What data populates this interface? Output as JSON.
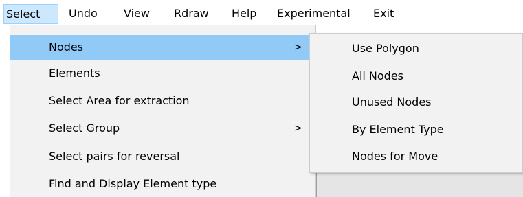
{
  "menubar": {
    "items": [
      {
        "label": "Select",
        "active": true
      },
      {
        "label": "Undo"
      },
      {
        "label": "View"
      },
      {
        "label": "Rdraw"
      },
      {
        "label": "Help"
      },
      {
        "label": "Experimental"
      },
      {
        "label": "Exit"
      }
    ]
  },
  "select_menu": {
    "items": [
      {
        "label": "Nodes",
        "submenu_arrow": ">"
      },
      {
        "label": "Elements"
      },
      {
        "label": "Select Area for extraction"
      },
      {
        "label": "Select Group",
        "submenu_arrow": ">"
      },
      {
        "label": "Select pairs for reversal"
      },
      {
        "label": "Find and Display Element type"
      }
    ]
  },
  "nodes_submenu": {
    "items": [
      {
        "label": "Use Polygon"
      },
      {
        "label": "All Nodes"
      },
      {
        "label": "Unused Nodes"
      },
      {
        "label": "By Element Type"
      },
      {
        "label": "Nodes for Move"
      }
    ]
  },
  "colors": {
    "menu_background": "#f2f2f2",
    "highlight": "#91c9f7",
    "active_menubar_item": "#cce8ff"
  }
}
